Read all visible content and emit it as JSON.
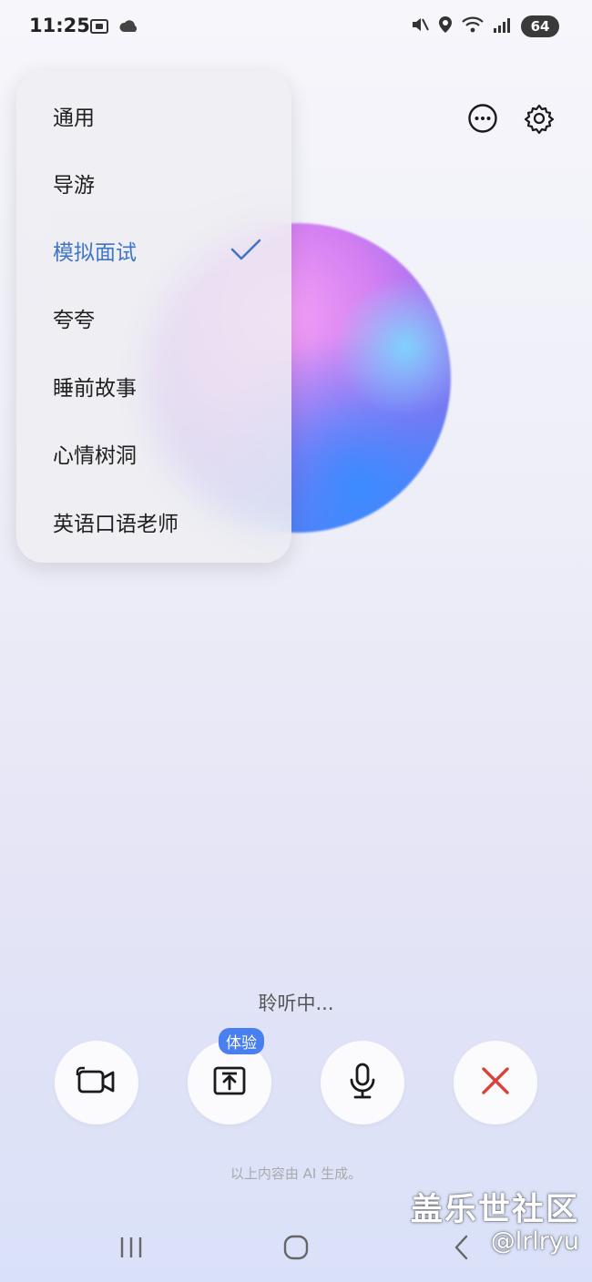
{
  "status_bar": {
    "time": "11:25",
    "left_icons": [
      "screen-record-icon",
      "cloud-icon"
    ],
    "right_icons": [
      "mute-vibrate-icon",
      "location-icon",
      "wifi-icon",
      "signal-5g-icon"
    ],
    "battery": "64"
  },
  "header": {
    "actions": [
      "more-icon",
      "settings-icon"
    ]
  },
  "menu": {
    "items": [
      {
        "label": "通用",
        "selected": false
      },
      {
        "label": "导游",
        "selected": false
      },
      {
        "label": "模拟面试",
        "selected": true
      },
      {
        "label": "夸夸",
        "selected": false
      },
      {
        "label": "睡前故事",
        "selected": false
      },
      {
        "label": "心情树洞",
        "selected": false
      },
      {
        "label": "英语口语老师",
        "selected": false
      }
    ],
    "accent_color": "#3f74c7"
  },
  "status_text": "聆听中...",
  "controls": {
    "camera_icon": "video-camera-icon",
    "upload_icon": "upload-icon",
    "upload_badge": "体验",
    "mic_icon": "microphone-icon",
    "close_icon": "close-icon",
    "close_color": "#d9433b"
  },
  "disclaimer": "以上内容由 AI 生成。",
  "watermark": {
    "title": "盖乐世社区",
    "handle": "@lrlryu"
  },
  "nav_bar": [
    "recent-apps-icon",
    "home-icon",
    "back-icon"
  ]
}
